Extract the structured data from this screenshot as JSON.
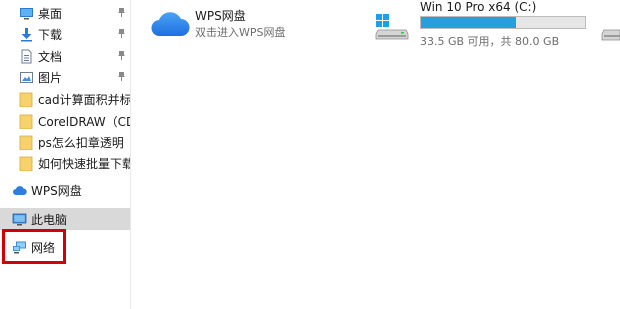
{
  "nav": {
    "quick_access": [
      {
        "label": "桌面",
        "icon": "desktop-icon",
        "pinned": true
      },
      {
        "label": "下载",
        "icon": "download-icon",
        "pinned": true
      },
      {
        "label": "文档",
        "icon": "document-icon",
        "pinned": true
      },
      {
        "label": "图片",
        "icon": "picture-icon",
        "pinned": true
      },
      {
        "label": "cad计算面积并标注",
        "icon": "folder-icon",
        "pinned": false
      },
      {
        "label": "CorelDRAW（CDR",
        "icon": "folder-icon",
        "pinned": false
      },
      {
        "label": "ps怎么扣章透明",
        "icon": "folder-icon",
        "pinned": false
      },
      {
        "label": "如何快速批量下载网",
        "icon": "folder-icon",
        "pinned": false
      }
    ],
    "wps_drive": "WPS网盘",
    "this_pc": "此电脑",
    "network": "网络"
  },
  "main": {
    "wps_tile": {
      "title": "WPS网盘",
      "subtitle": "双击进入WPS网盘"
    },
    "drive_c": {
      "title": "Win 10 Pro x64 (C:)",
      "space_text": "33.5 GB 可用，共 80.0 GB",
      "used_fraction": 0.58
    }
  },
  "colors": {
    "usage_bar": "#26a0da",
    "highlight": "#d40000",
    "selected_bg": "#d9d9d9"
  }
}
